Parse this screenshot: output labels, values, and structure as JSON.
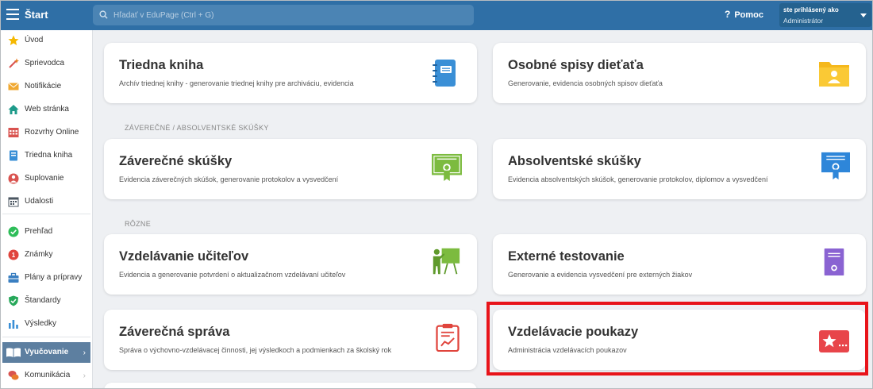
{
  "topbar": {
    "title": "Štart",
    "search_placeholder": "Hľadať v EduPage (Ctrl + G)",
    "help_label": "Pomoc",
    "user_name": "ste prihlásený ako",
    "user_role": "Administrátor"
  },
  "sidebar": {
    "items": [
      {
        "label": "Úvod",
        "icon": "star-icon"
      },
      {
        "label": "Sprievodca",
        "icon": "wand-icon"
      },
      {
        "label": "Notifikácie",
        "icon": "envelope-icon"
      },
      {
        "label": "Web stránka",
        "icon": "home-icon"
      },
      {
        "label": "Rozvrhy Online",
        "icon": "calendar-grid-icon"
      },
      {
        "label": "Triedna kniha",
        "icon": "book-icon"
      },
      {
        "label": "Suplovanie",
        "icon": "person-swap-icon"
      },
      {
        "label": "Udalosti",
        "icon": "calendar-icon"
      },
      {
        "label": "Prehľad",
        "icon": "check-circle-icon"
      },
      {
        "label": "Známky",
        "icon": "grade-icon"
      },
      {
        "label": "Plány a prípravy",
        "icon": "briefcase-icon"
      },
      {
        "label": "Štandardy",
        "icon": "shield-check-icon"
      },
      {
        "label": "Výsledky",
        "icon": "bar-chart-icon"
      },
      {
        "label": "Vyučovanie",
        "icon": "open-book-icon"
      },
      {
        "label": "Komunikácia",
        "icon": "chat-icon"
      }
    ]
  },
  "sections": {
    "final_exams": "ZÁVEREČNÉ / ABSOLVENTSKÉ SKÚŠKY",
    "misc": "RÔZNE"
  },
  "cards": [
    {
      "title": "Triedna kniha",
      "subtitle": "Archív triednej knihy - generovanie triednej knihy pre archiváciu, evidencia",
      "icon": "notebook-icon"
    },
    {
      "title": "Osobné spisy dieťaťa",
      "subtitle": "Generovanie, evidencia osobných spisov dieťaťa",
      "icon": "folder-person-icon"
    },
    {
      "title": "Záverečné skúšky",
      "subtitle": "Evidencia záverečných skúšok, generovanie protokolov a vysvedčení",
      "icon": "certificate-green-icon"
    },
    {
      "title": "Absolventské skúšky",
      "subtitle": "Evidencia absolventských skúšok, generovanie protokolov, diplomov a vysvedčení",
      "icon": "certificate-blue-icon"
    },
    {
      "title": "Vzdelávanie učiteľov",
      "subtitle": "Evidencia a generovanie potvrdení o aktualizačnom vzdelávaní učiteľov",
      "icon": "teacher-board-icon"
    },
    {
      "title": "Externé testovanie",
      "subtitle": "Generovanie a evidencia vysvedčení pre externých žiakov",
      "icon": "diploma-purple-icon"
    },
    {
      "title": "Záverečná správa",
      "subtitle": "Správa o výchovno-vzdelávacej činnosti, jej výsledkoch a podmienkach za školský rok",
      "icon": "clipboard-chart-icon"
    },
    {
      "title": "Vzdelávacie poukazy",
      "subtitle": "Administrácia vzdelávacích poukazov",
      "icon": "voucher-star-icon"
    }
  ],
  "colors": {
    "topbar": "#2f6fa6",
    "highlight": "#e8141a",
    "active_nav": "#5d7fa0"
  }
}
